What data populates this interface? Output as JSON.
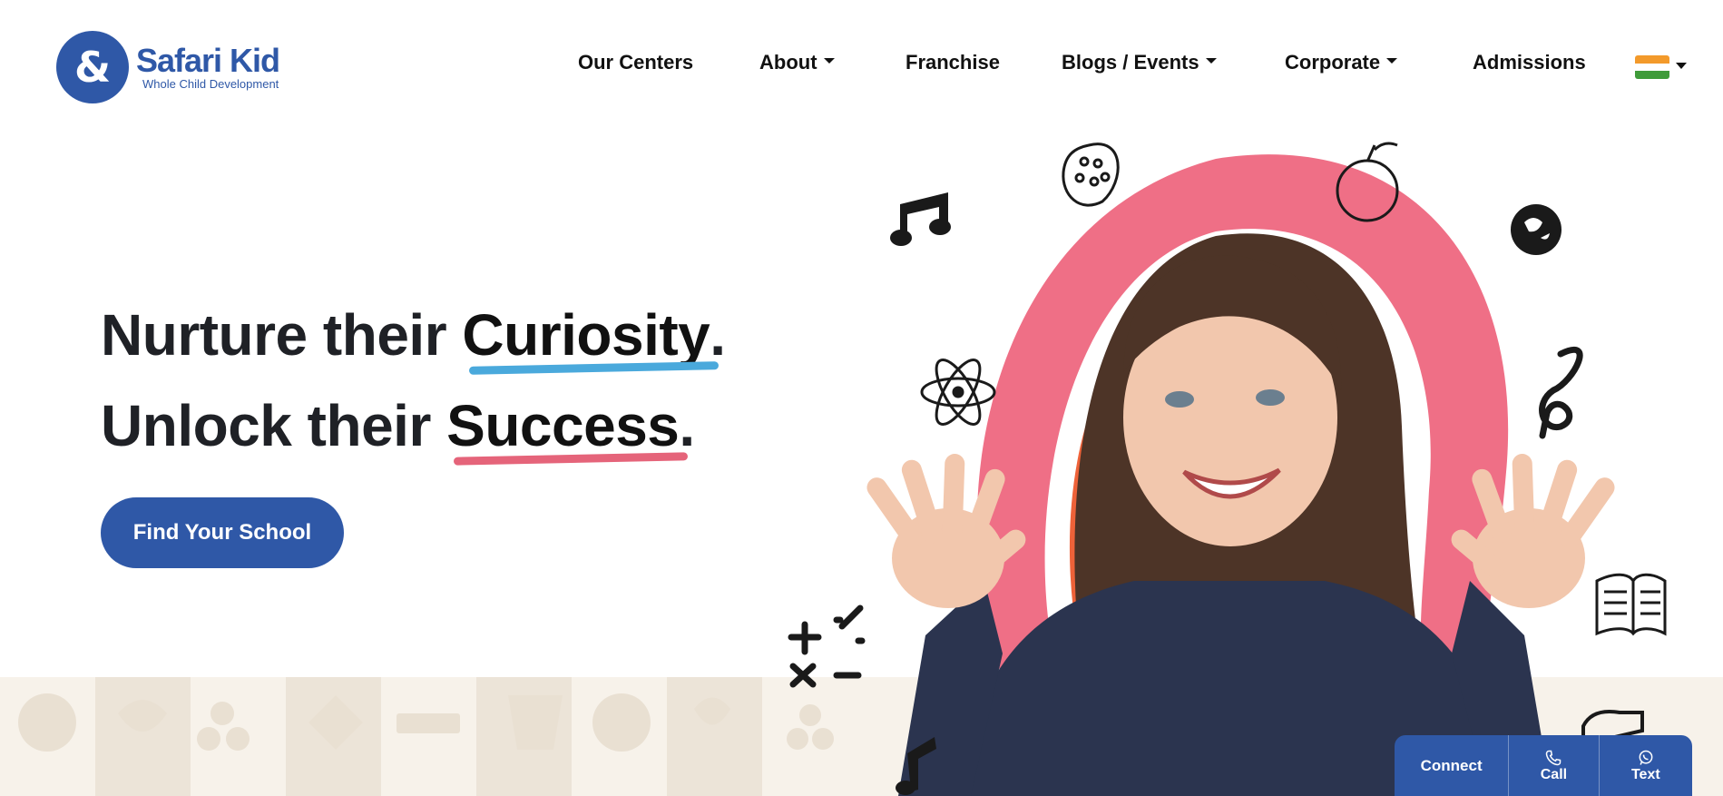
{
  "brand": {
    "name": "Safari Kid",
    "tagline": "Whole Child Development",
    "mark": "&",
    "color": "#2f58a7"
  },
  "nav": {
    "items": [
      {
        "label": "Our Centers",
        "dropdown": false
      },
      {
        "label": "About",
        "dropdown": true
      },
      {
        "label": "Franchise",
        "dropdown": false
      },
      {
        "label": "Blogs / Events",
        "dropdown": true
      },
      {
        "label": "Corporate",
        "dropdown": true
      },
      {
        "label": "Admissions",
        "dropdown": false
      }
    ],
    "language_flag": "india-flag-icon"
  },
  "hero": {
    "line1_prefix": "Nurture their",
    "line1_highlight": "Curiosity",
    "line2_prefix": "Unlock their",
    "line2_highlight": "Success",
    "punctuation": ".",
    "cta_label": "Find Your School",
    "underline_colors": [
      "#4aa9dc",
      "#e5647a"
    ]
  },
  "connect_widget": {
    "main_label": "Connect",
    "call_label": "Call",
    "text_label": "Text"
  },
  "colors": {
    "primary": "#2f58a7",
    "pink_ring": "#ef6f86",
    "orange_ring": "#ee6239",
    "band": "#f7f2ea"
  }
}
